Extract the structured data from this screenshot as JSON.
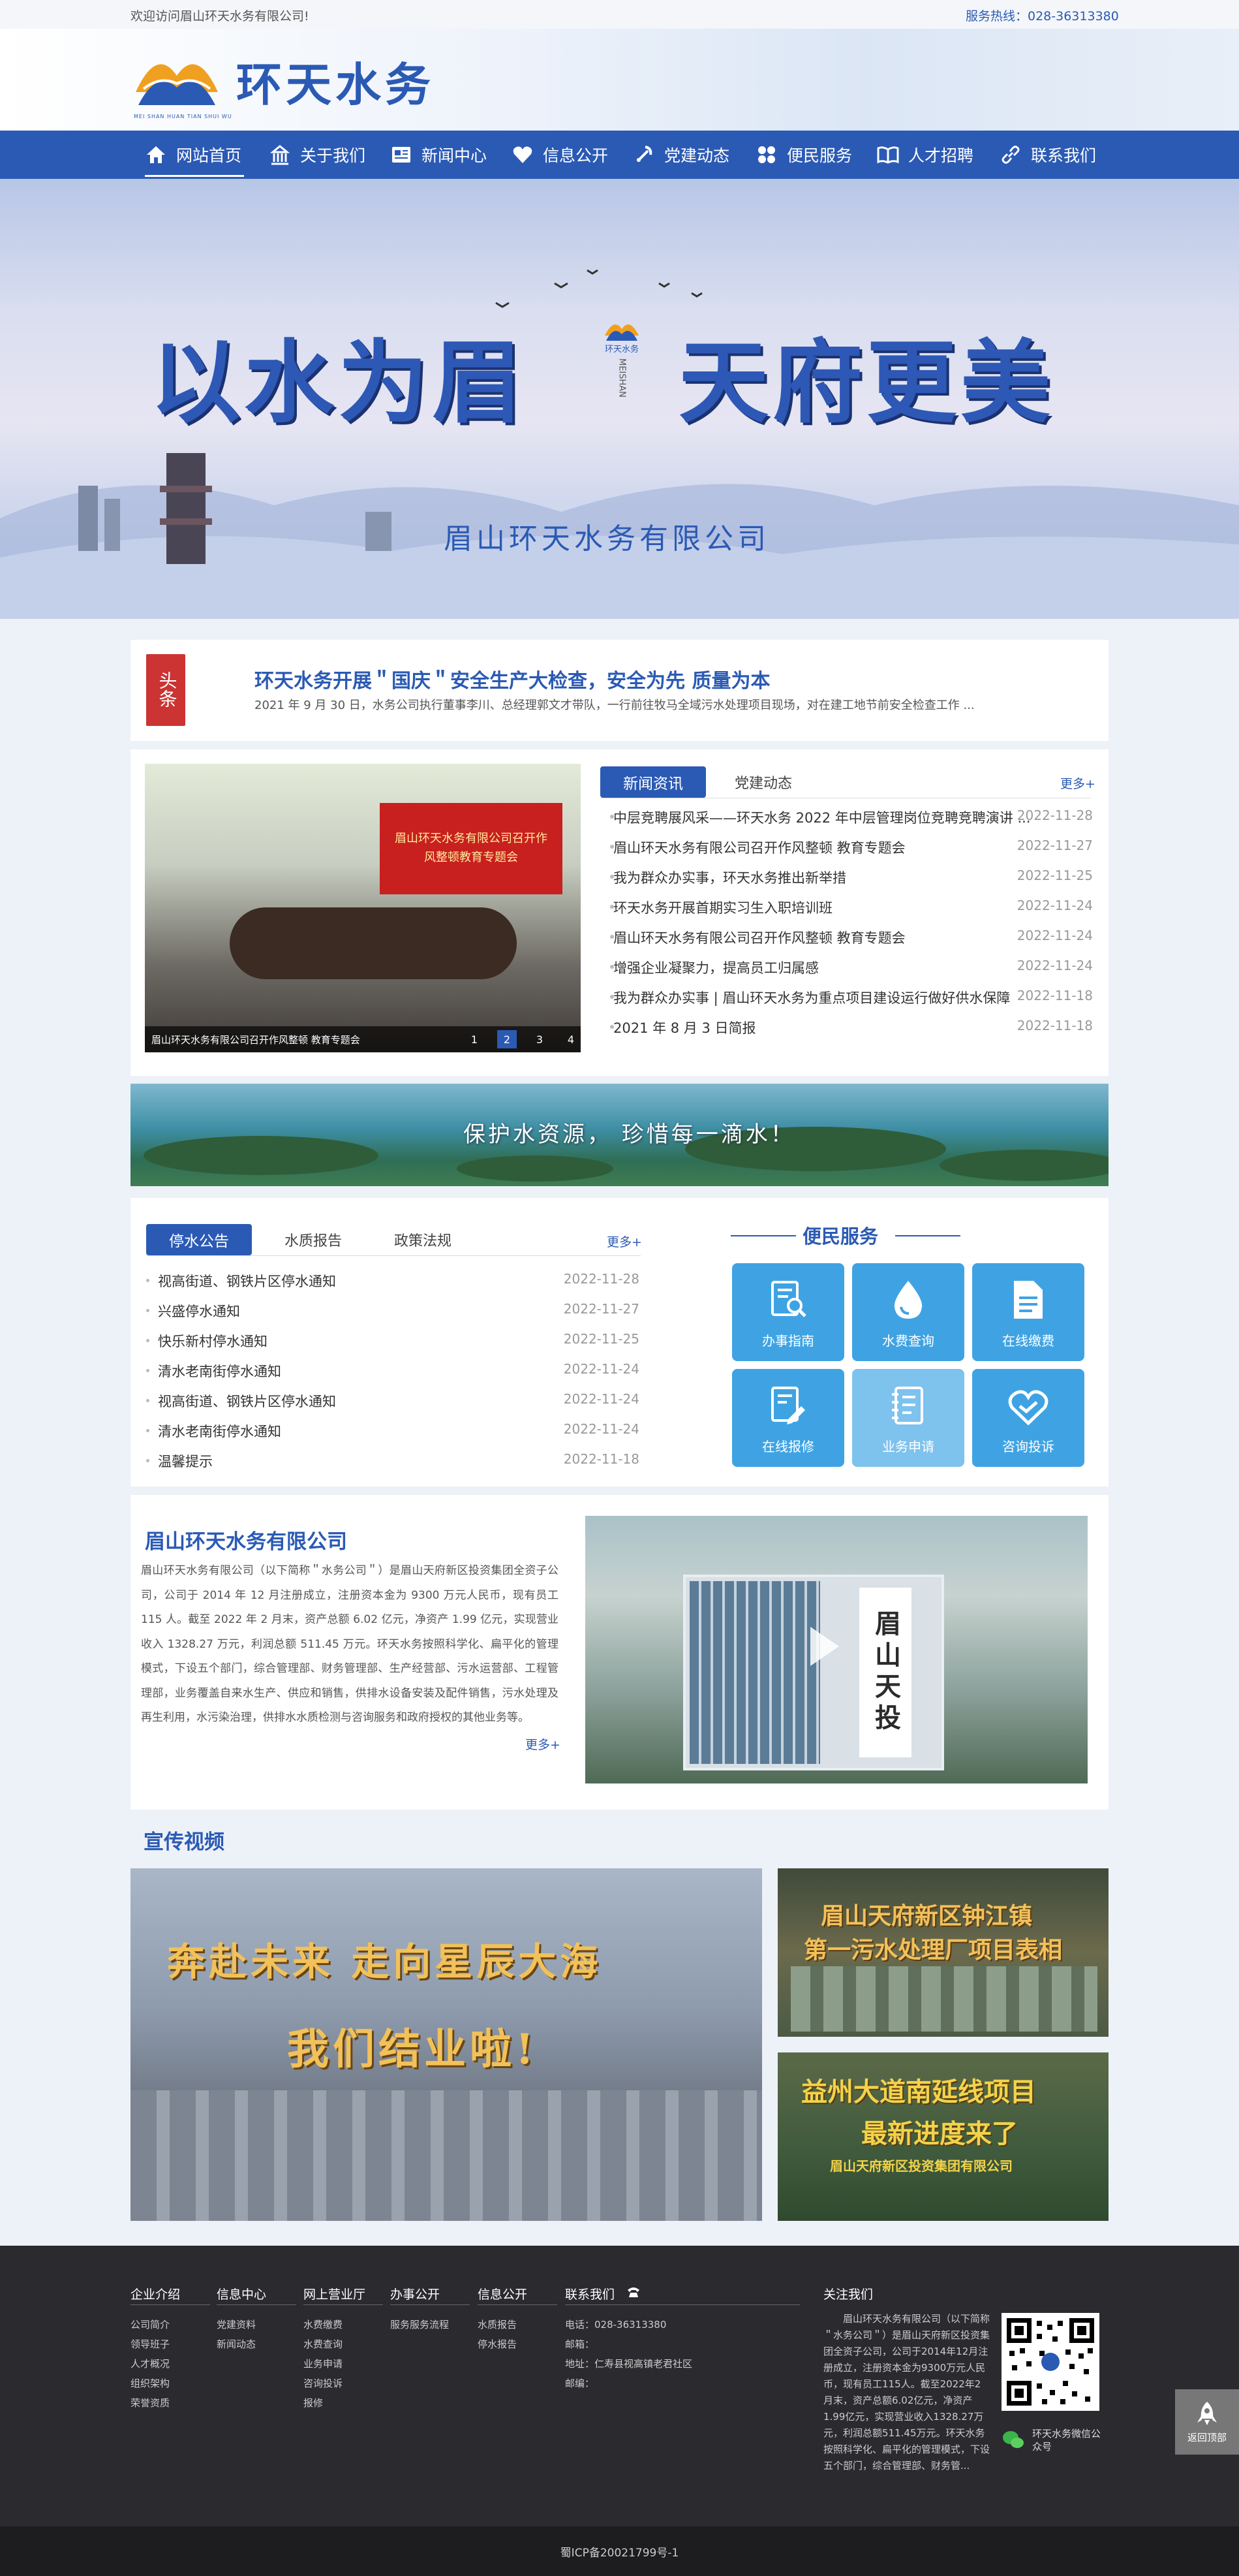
{
  "topbar": {
    "welcome": "欢迎访问眉山环天水务有限公司!",
    "hotline": "服务热线：028-36313380"
  },
  "header": {
    "logo_text": "环天水务",
    "logo_small": "MEI SHAN HUAN TIAN SHUI WU"
  },
  "nav": {
    "items": [
      {
        "label": "网站首页",
        "icon": "home-icon"
      },
      {
        "label": "关于我们",
        "icon": "building-icon"
      },
      {
        "label": "新闻中心",
        "icon": "news-icon"
      },
      {
        "label": "信息公开",
        "icon": "heart-icon"
      },
      {
        "label": "党建动态",
        "icon": "party-icon"
      },
      {
        "label": "便民服务",
        "icon": "grid-icon"
      },
      {
        "label": "人才招聘",
        "icon": "book-icon"
      },
      {
        "label": "联系我们",
        "icon": "link-icon"
      }
    ]
  },
  "banner": {
    "slogan_left": "以水为眉",
    "slogan_right": "天府更美",
    "company": "眉山环天水务有限公司",
    "badge_top": "环天水务",
    "badge_side": "MEISHAN"
  },
  "headline": {
    "tag": "头条",
    "title": "环天水务开展＂国庆＂安全生产大检查，安全为先 质量为本",
    "summary": "2021 年 9 月 30 日，水务公司执行董事李川、总经理郭文才带队，一行前往牧马全域污水处理项目现场，对在建工地节前安全检查工作 ..."
  },
  "news": {
    "slide_caption": "眉山环天水务有限公司召开作风整顿 教育专题会",
    "slide_screen": "眉山环天水务有限公司召开作风整顿教育专题会",
    "pages": [
      "1",
      "2",
      "3",
      "4"
    ],
    "tabs": [
      "新闻资讯",
      "党建动态"
    ],
    "more": "更多+",
    "items": [
      {
        "title": "中层竞聘展风采——环天水务 2022 年中层管理岗位竞聘竞聘演讲 ...",
        "date": "2022-11-28"
      },
      {
        "title": "眉山环天水务有限公司召开作风整顿 教育专题会",
        "date": "2022-11-27"
      },
      {
        "title": "我为群众办实事，环天水务推出新举措",
        "date": "2022-11-25"
      },
      {
        "title": "环天水务开展首期实习生入职培训班",
        "date": "2022-11-24"
      },
      {
        "title": "眉山环天水务有限公司召开作风整顿 教育专题会",
        "date": "2022-11-24"
      },
      {
        "title": "增强企业凝聚力，提高员工归属感",
        "date": "2022-11-24"
      },
      {
        "title": "我为群众办实事 | 眉山环天水务为重点项目建设运行做好供水保障",
        "date": "2022-11-18"
      },
      {
        "title": "2021 年 8 月 3 日简报",
        "date": "2022-11-18"
      }
    ]
  },
  "strip": {
    "text": "保护水资源，  珍惜每一滴水！"
  },
  "notice": {
    "tabs": [
      "停水公告",
      "水质报告",
      "政策法规"
    ],
    "more": "更多+",
    "items": [
      {
        "title": "视高街道、钢铁片区停水通知",
        "date": "2022-11-28"
      },
      {
        "title": "兴盛停水通知",
        "date": "2022-11-27"
      },
      {
        "title": "快乐新村停水通知",
        "date": "2022-11-25"
      },
      {
        "title": "清水老南街停水通知",
        "date": "2022-11-24"
      },
      {
        "title": "视高街道、钢铁片区停水通知",
        "date": "2022-11-24"
      },
      {
        "title": "清水老南街停水通知",
        "date": "2022-11-24"
      },
      {
        "title": "温馨提示",
        "date": "2022-11-18"
      }
    ]
  },
  "services": {
    "title": "便民服务",
    "items": [
      {
        "label": "办事指南",
        "icon": "guide-icon"
      },
      {
        "label": "水费查询",
        "icon": "water-drop-icon"
      },
      {
        "label": "在线缴费",
        "icon": "document-icon"
      },
      {
        "label": "在线报修",
        "icon": "repair-icon"
      },
      {
        "label": "业务申请",
        "icon": "notebook-icon"
      },
      {
        "label": "咨询投诉",
        "icon": "heart-outline-icon"
      }
    ]
  },
  "about": {
    "title": "眉山环天水务有限公司",
    "text": "眉山环天水务有限公司（以下简称＂水务公司＂）是眉山天府新区投资集团全资子公司，公司于 2014 年 12 月注册成立，注册资本金为 9300 万元人民币，现有员工 115 人。截至 2022 年 2 月末，资产总额 6.02 亿元，净资产 1.99 亿元，实现营业收入 1328.27 万元，利润总额 511.45 万元。环天水务按照科学化、扁平化的管理模式，下设五个部门，综合管理部、财务管理部、生产经营部、污水运营部、工程管理部，业务覆盖自来水生产、供应和销售，供排水设备安装及配件销售，污水处理及再生利用，水污染治理，供排水水质检测与咨询服务和政府授权的其他业务等。",
    "more": "更多+",
    "building_sign": "眉山天投"
  },
  "video": {
    "title": "宣传视频",
    "main_line1": "奔赴未来 走向星辰大海",
    "main_line2": "我们结业啦!",
    "side1_line1": "眉山天府新区钟江镇",
    "side1_line2": "第一污水处理厂项目表相",
    "side2_line1": "益州大道南延线项目",
    "side2_line2": "最新进度来了",
    "side2_line3": "眉山天府新区投资集团有限公司"
  },
  "footer": {
    "cols": [
      {
        "title": "企业介绍",
        "links": [
          "公司简介",
          "领导班子",
          "人才概况",
          "组织架构",
          "荣誉资质"
        ]
      },
      {
        "title": "信息中心",
        "links": [
          "党建资料",
          "新闻动态"
        ]
      },
      {
        "title": "网上营业厅",
        "links": [
          "水费缴费",
          "水费查询",
          "业务申请",
          "咨询投诉",
          "报修"
        ]
      },
      {
        "title": "办事公开",
        "links": [
          "服务服务流程"
        ]
      },
      {
        "title": "信息公开",
        "links": [
          "水质报告",
          "停水报告"
        ]
      }
    ],
    "contact_title": "联系我们",
    "contact_icon": "phone-icon",
    "contact": [
      "电话：028-36313380",
      "邮箱：",
      "地址：仁寿县视高镇老君社区",
      "邮编："
    ],
    "follow_title": "关注我们",
    "follow_text": "眉山环天水务有限公司（以下简称＂水务公司＂）是眉山天府新区投资集团全资子公司，公司于2014年12月注册成立，注册资本金为9300万元人民币，现有员工115人。截至2022年2月末，资产总额6.02亿元，净资产1.99亿元，实现营业收入1328.27万元，利润总额511.45万元。环天水务按照科学化、扁平化的管理模式，下设五个部门，综合管理部、财务管...",
    "wechat_label": "环天水务微信公众号",
    "back_top": "返回顶部",
    "icp": "蜀ICP备20021799号-1"
  }
}
